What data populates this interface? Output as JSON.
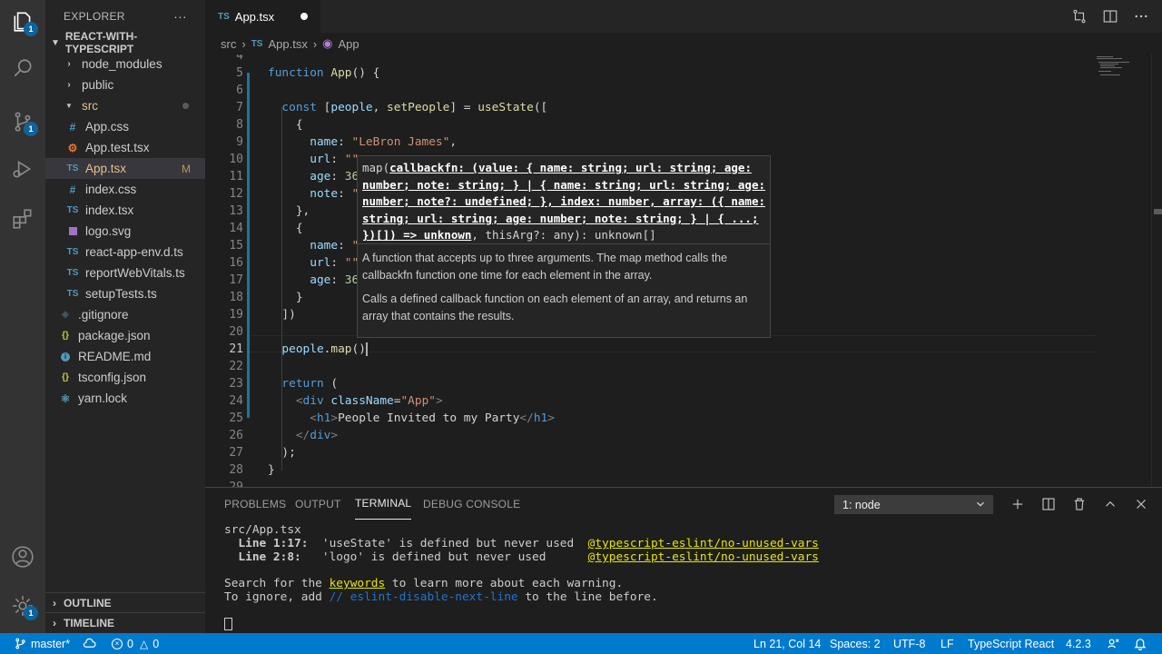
{
  "sidebar": {
    "title": "EXPLORER",
    "more": "···",
    "project": "REACT-WITH-TYPESCRIPT",
    "items": [
      {
        "label": "node_modules",
        "icon": "chevron-right"
      },
      {
        "label": "public",
        "icon": "chevron-right"
      },
      {
        "label": "src",
        "icon": "chevron-down"
      },
      {
        "label": "App.css",
        "icon": "#"
      },
      {
        "label": "App.test.tsx",
        "icon": "gear"
      },
      {
        "label": "App.tsx",
        "icon": "TS",
        "mark": "M"
      },
      {
        "label": "index.css",
        "icon": "#"
      },
      {
        "label": "index.tsx",
        "icon": "TS"
      },
      {
        "label": "logo.svg",
        "icon": "svg"
      },
      {
        "label": "react-app-env.d.ts",
        "icon": "TS"
      },
      {
        "label": "reportWebVitals.ts",
        "icon": "TS"
      },
      {
        "label": "setupTests.ts",
        "icon": "TS"
      },
      {
        "label": ".gitignore",
        "icon": "git"
      },
      {
        "label": "package.json",
        "icon": "{}"
      },
      {
        "label": "README.md",
        "icon": "info"
      },
      {
        "label": "tsconfig.json",
        "icon": "{}"
      },
      {
        "label": "yarn.lock",
        "icon": "yarn"
      }
    ],
    "outline": "OUTLINE",
    "timeline": "TIMELINE"
  },
  "activity": {
    "badges": [
      "1",
      "1",
      "1"
    ]
  },
  "tab": {
    "icon": "TS",
    "label": "App.tsx"
  },
  "breadcrumb": {
    "folder": "src",
    "sep": "›",
    "file_icon": "TS",
    "file": "App.tsx",
    "symbol": "App"
  },
  "editor": {
    "line_numbers": [
      "4",
      "5",
      "6",
      "7",
      "8",
      "9",
      "10",
      "11",
      "12",
      "13",
      "14",
      "15",
      "16",
      "17",
      "18",
      "19",
      "20",
      "21",
      "22",
      "23",
      "24",
      "25",
      "26",
      "27",
      "28",
      "29"
    ],
    "current_line": "21"
  },
  "hover": {
    "sig_prefix": "map(",
    "sig_param": "callbackfn: (value: { name: string; url: string; age: number; note: string; } | { name: string; url: string; age: number; note?: undefined; }, index: number, array: ({ name: string; url: string; age: number; note: string; } | { ...; })[]) => unknown",
    "sig_suffix": ", thisArg?: any): unknown[]",
    "doc1": "A function that accepts up to three arguments. The map method calls the callbackfn function one time for each element in the array.",
    "doc2": "Calls a defined callback function on each element of an array, and returns an array that contains the results."
  },
  "panel": {
    "tabs": [
      "PROBLEMS",
      "OUTPUT",
      "TERMINAL",
      "DEBUG CONSOLE"
    ],
    "active_tab": "TERMINAL",
    "terminal_select": "1: node",
    "terminal": {
      "file": "src/App.tsx",
      "w1_loc": "  Line 1:17:",
      "w1_msg": "  'useState' is defined but never used  ",
      "w1_rule": "@typescript-eslint/no-unused-vars",
      "w2_loc": "  Line 2:8:",
      "w2_msg": "   'logo' is defined but never used      ",
      "w2_rule": "@typescript-eslint/no-unused-vars",
      "search_pre": "Search for the ",
      "search_kw": "keywords",
      "search_post": " to learn more about each warning.",
      "ignore_pre": "To ignore, add ",
      "ignore_kw": "// eslint-disable-next-line",
      "ignore_post": " to the line before."
    }
  },
  "status": {
    "branch": "master*",
    "errors": "0",
    "warnings": "0",
    "position": "Ln 21, Col 14",
    "spaces": "Spaces: 2",
    "encoding": "UTF-8",
    "eol": "LF",
    "language": "TypeScript React",
    "version": "4.2.3"
  },
  "colors": {
    "accent": "#007acc",
    "activity_bg": "#333333",
    "sidebar_bg": "#252526",
    "editor_bg": "#1e1e1e"
  }
}
